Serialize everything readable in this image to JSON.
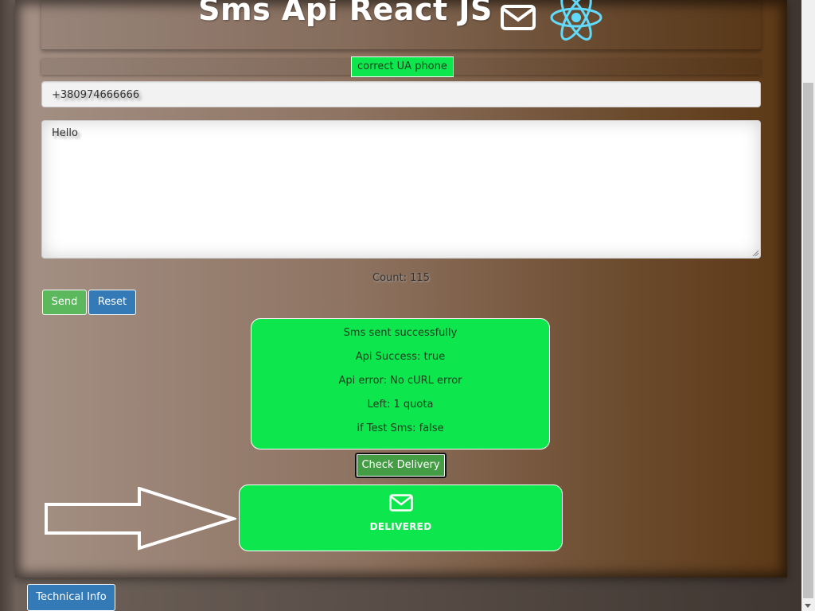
{
  "header": {
    "title": "Sms Api React JS",
    "icons": [
      "envelope-icon",
      "react-logo-icon"
    ]
  },
  "phone_status": "correct UA phone",
  "phone_input": {
    "value": "+380974666666"
  },
  "message_input": {
    "value": "Hello"
  },
  "count_label": "Count: 115",
  "buttons": {
    "send": "Send",
    "reset": "Reset",
    "check_delivery": "Check Delivery",
    "technical_info": "Technical Info"
  },
  "result": {
    "lines": [
      "Sms sent successfully",
      "Api Success: true",
      "Api error: No cURL error",
      "Left: 1 quota",
      "if Test Sms: false"
    ]
  },
  "delivery": {
    "icon": "envelope-icon",
    "status": "DELIVERED"
  },
  "colors": {
    "success_green": "#0ee64d",
    "send_green": "#5cb85c",
    "primary_blue": "#337ab7",
    "check_green": "#449d44",
    "react_blue": "#61dafb"
  }
}
